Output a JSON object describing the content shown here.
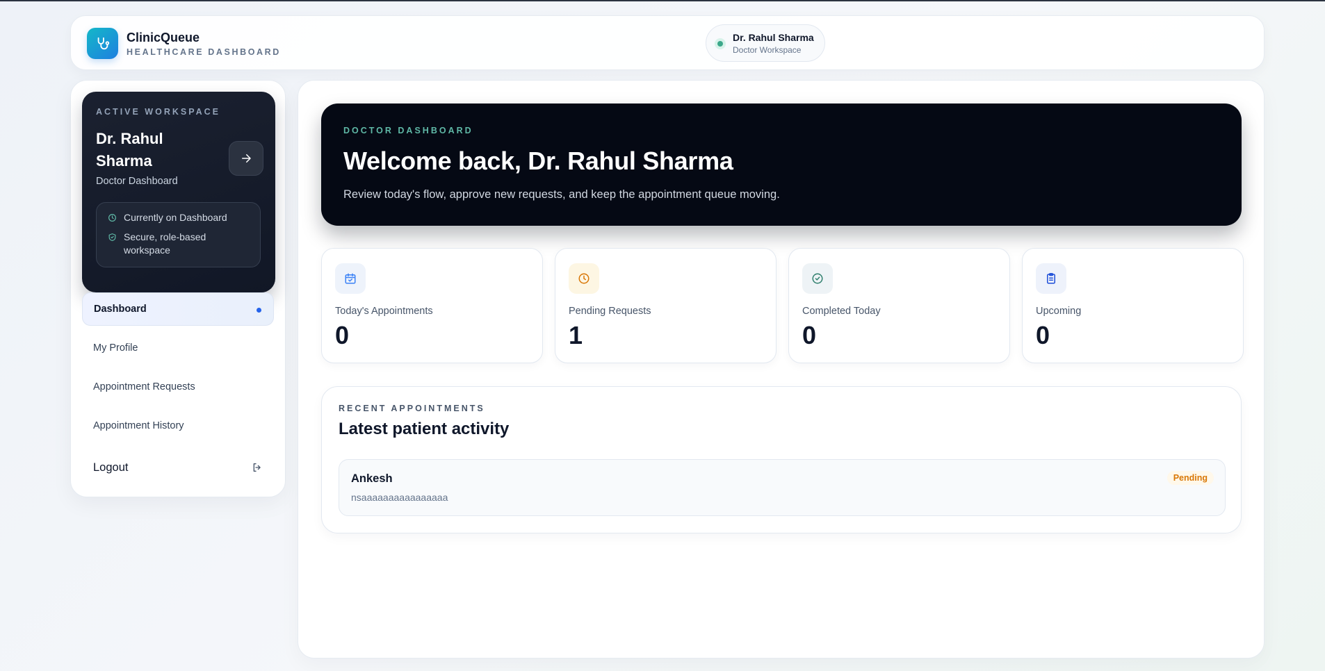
{
  "header": {
    "brand_name": "ClinicQueue",
    "brand_subtitle": "HEALTHCARE DASHBOARD",
    "user_name": "Dr. Rahul Sharma",
    "user_role": "Doctor Workspace"
  },
  "sidebar": {
    "workspace": {
      "kicker": "ACTIVE WORKSPACE",
      "name": "Dr. Rahul Sharma",
      "role": "Doctor Dashboard",
      "status_current": "Currently on Dashboard",
      "status_secure": "Secure, role-based workspace"
    },
    "items": [
      {
        "label": "Dashboard",
        "active": true
      },
      {
        "label": "My Profile",
        "active": false
      },
      {
        "label": "Appointment Requests",
        "active": false
      },
      {
        "label": "Appointment History",
        "active": false
      }
    ],
    "logout_label": "Logout"
  },
  "hero": {
    "kicker": "DOCTOR DASHBOARD",
    "title": "Welcome back, Dr. Rahul Sharma",
    "subtitle": "Review today's flow, approve new requests, and keep the appointment queue moving."
  },
  "stats": [
    {
      "label": "Today's Appointments",
      "value": "0",
      "icon": "calendar-icon",
      "icon_color": "#3b82f6"
    },
    {
      "label": "Pending Requests",
      "value": "1",
      "icon": "clock-icon",
      "icon_color": "#d97706"
    },
    {
      "label": "Completed Today",
      "value": "0",
      "icon": "check-circle-icon",
      "icon_color": "#2f7f6d"
    },
    {
      "label": "Upcoming",
      "value": "0",
      "icon": "clipboard-icon",
      "icon_color": "#1d4ed8"
    }
  ],
  "recent": {
    "kicker": "RECENT APPOINTMENTS",
    "title": "Latest patient activity",
    "appointments": [
      {
        "patient": "Ankesh",
        "detail": "nsaaaaaaaaaaaaaaaa",
        "status": "Pending"
      }
    ]
  },
  "colors": {
    "accent": "#2563eb",
    "teal": "#5fb8a6",
    "pending": "#d97706",
    "hero_bg": "#050914"
  }
}
